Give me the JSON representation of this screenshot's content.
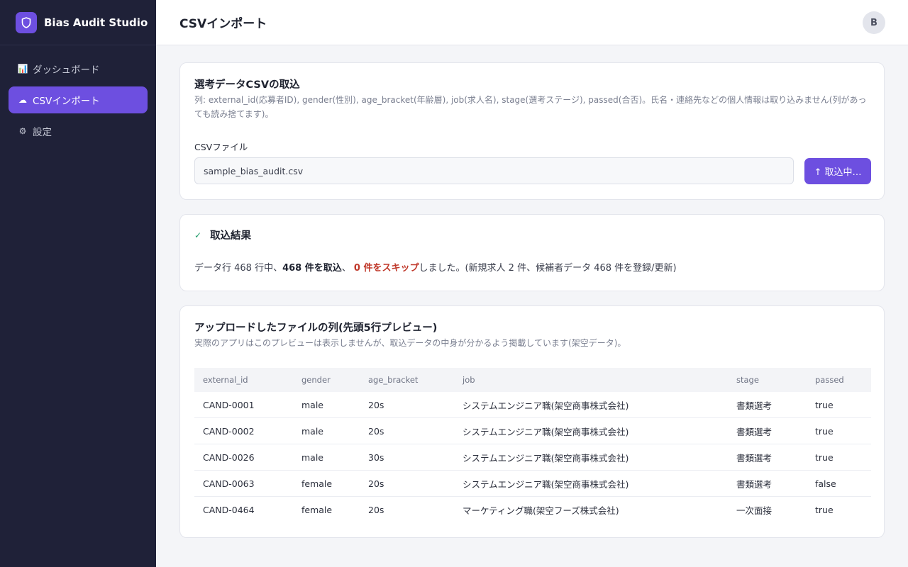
{
  "app": {
    "name": "Bias Audit Studio",
    "avatar_initial": "B"
  },
  "sidebar": {
    "items": [
      {
        "icon": "📊",
        "label": "ダッシュボード",
        "active": false
      },
      {
        "icon": "☁",
        "label": "CSVインポート",
        "active": true
      },
      {
        "icon": "⚙",
        "label": "設定",
        "active": false
      }
    ]
  },
  "header": {
    "title": "CSVインポート"
  },
  "import_card": {
    "title": "選考データCSVの取込",
    "description": "列: external_id(応募者ID), gender(性別), age_bracket(年齢層), job(求人名), stage(選考ステージ), passed(合否)。氏名・連絡先などの個人情報は取り込みません(列があっても読み捨てます)。",
    "file_label": "CSVファイル",
    "file_value": "sample_bias_audit.csv",
    "button_label": "↑ 取込中…"
  },
  "result_card": {
    "title": "取込結果",
    "text_prefix": "データ行 468 行中、",
    "imported": "468 件を取込",
    "separator": "、 ",
    "skipped": "0 件をスキップ",
    "text_suffix": "しました。(新規求人 2 件、候補者データ 468 件を登録/更新)"
  },
  "preview_card": {
    "title": "アップロードしたファイルの列(先頭5行プレビュー)",
    "description": "実際のアプリはこのプレビューは表示しませんが、取込データの中身が分かるよう掲載しています(架空データ)。",
    "columns": [
      "external_id",
      "gender",
      "age_bracket",
      "job",
      "stage",
      "passed"
    ],
    "rows": [
      [
        "CAND-0001",
        "male",
        "20s",
        "システムエンジニア職(架空商事株式会社)",
        "書類選考",
        "true"
      ],
      [
        "CAND-0002",
        "male",
        "20s",
        "システムエンジニア職(架空商事株式会社)",
        "書類選考",
        "true"
      ],
      [
        "CAND-0026",
        "male",
        "30s",
        "システムエンジニア職(架空商事株式会社)",
        "書類選考",
        "true"
      ],
      [
        "CAND-0063",
        "female",
        "20s",
        "システムエンジニア職(架空商事株式会社)",
        "書類選考",
        "false"
      ],
      [
        "CAND-0464",
        "female",
        "20s",
        "マーケティング職(架空フーズ株式会社)",
        "一次面接",
        "true"
      ]
    ]
  },
  "colors": {
    "accent": "#6d4fe0",
    "sidebar_bg": "#1f2138",
    "skip_red": "#c0392b",
    "success_green": "#1f9d6a"
  }
}
